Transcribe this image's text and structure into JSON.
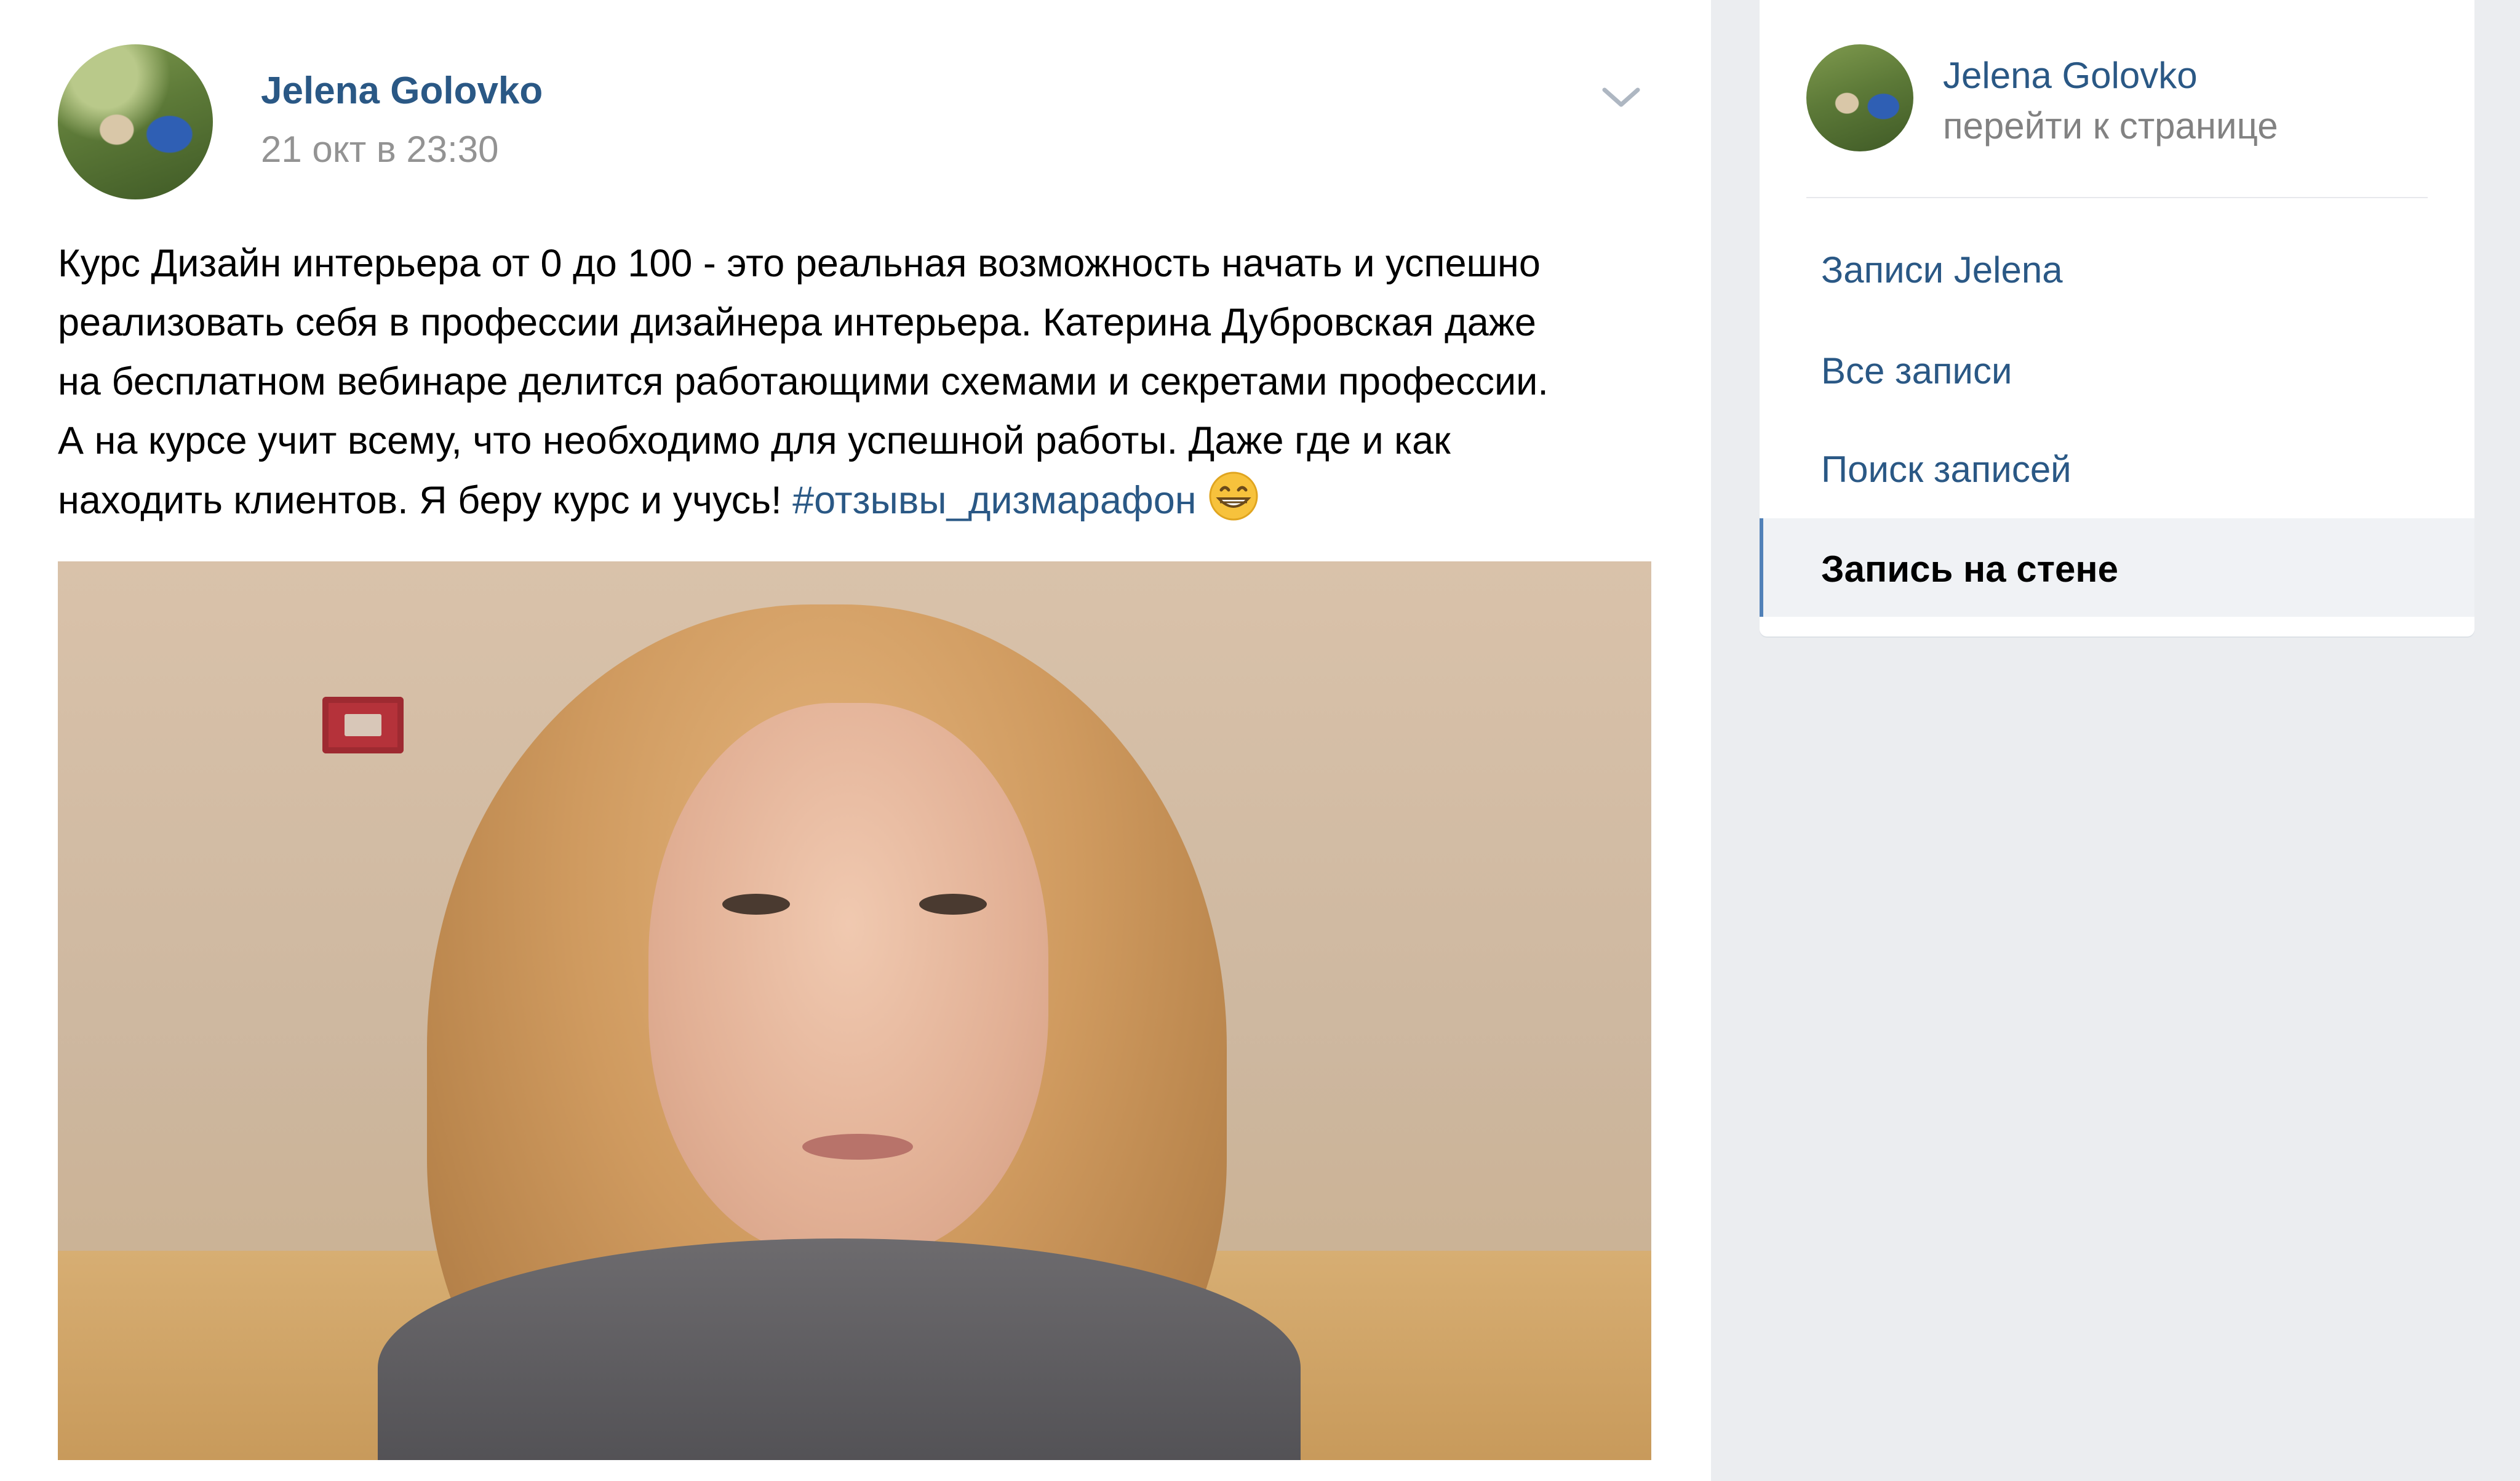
{
  "post": {
    "author_name": "Jelena Golovko",
    "date": "21 окт в 23:30",
    "text_lines": [
      "Курс Дизайн интерьера от 0 до 100 - это реальная возможность начать и успешно",
      "реализовать себя в профессии дизайнера интерьера. Катерина Дубровская даже",
      "на бесплатном вебинаре делится работающими схемами и секретами профессии.",
      "А на курсе учит всему, что необходимо для успешной работы. Даже где и как",
      "находить клиентов. Я беру курс и учусь! "
    ],
    "hashtag": "#отзывы_дизмарафон",
    "emoji": "grinning-face-emoji",
    "menu_icon": "chevron-down-icon"
  },
  "sidebar": {
    "name": "Jelena Golovko",
    "goto_label": "перейти к странице",
    "items": [
      {
        "label": "Записи Jelena",
        "active": false
      },
      {
        "label": "Все записи",
        "active": false
      },
      {
        "label": "Поиск записей",
        "active": false
      },
      {
        "label": "Запись на стене",
        "active": true
      }
    ]
  },
  "colors": {
    "link": "#2a5885",
    "date": "#939393",
    "active_indicator": "#5181b8",
    "background": "#ebedf0"
  }
}
